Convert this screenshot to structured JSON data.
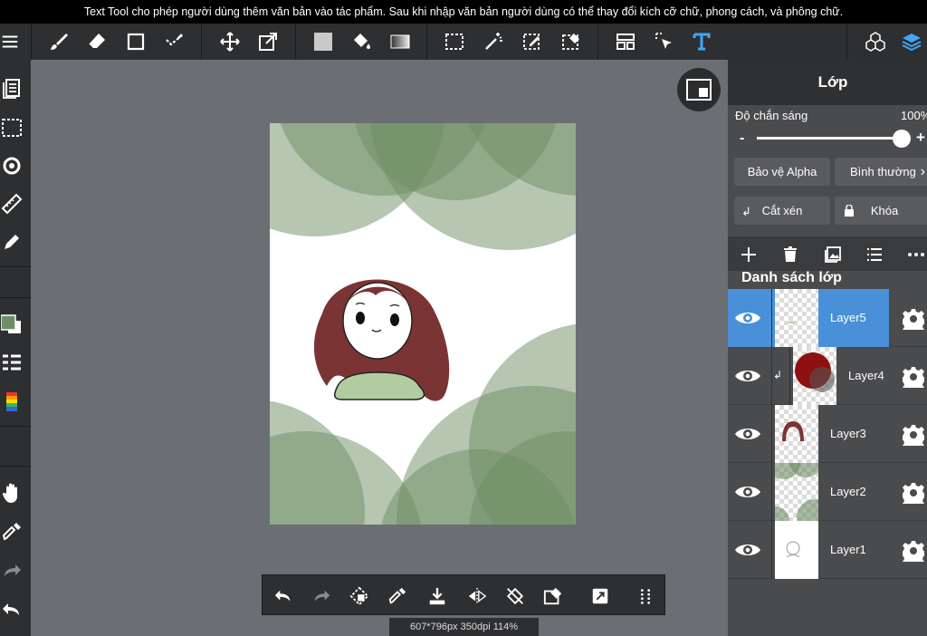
{
  "banner": {
    "text": "Text Tool cho phép người dùng thêm văn bản vào tác phẩm. Sau khi nhập văn bản người dùng có thể thay đổi kích cỡ chữ, phong cách, và phông chữ."
  },
  "toolbar": {
    "icons": [
      "menu-icon",
      "brush-icon",
      "eraser-icon",
      "square-icon",
      "selection-check-icon",
      "move-icon",
      "transform-icon",
      "fill-color-icon",
      "bucket-icon",
      "gradient-icon",
      "marquee-icon",
      "magic-wand-icon",
      "select-pen-icon",
      "select-eraser-icon",
      "layout-icon",
      "cursor-select-icon",
      "text-icon",
      "3d-cube-icon",
      "layers-icon"
    ]
  },
  "colors": {
    "accent": "#4a90d9",
    "green_bg": "#6e8e64",
    "hair": "#7a3434",
    "shirt": "#b3cc9f"
  },
  "canvas": {
    "status": "607*796px 350dpi 114%"
  },
  "panel": {
    "title": "Lớp",
    "opacity_label": "Độ chắn sáng",
    "opacity_value": "100%",
    "opacity_percent": 100,
    "slider_minus": "-",
    "slider_plus": "+",
    "alpha_protect": "Bảo vệ Alpha",
    "blend_mode": "Bình thường",
    "clip": "Cắt xén",
    "lock": "Khóa",
    "list_title": "Danh sách lớp",
    "layers": [
      {
        "name": "Layer5",
        "selected": true,
        "clipped": false
      },
      {
        "name": "Layer4",
        "selected": false,
        "clipped": true
      },
      {
        "name": "Layer3",
        "selected": false,
        "clipped": false
      },
      {
        "name": "Layer2",
        "selected": false,
        "clipped": false
      },
      {
        "name": "Layer1",
        "selected": false,
        "clipped": false
      }
    ]
  }
}
